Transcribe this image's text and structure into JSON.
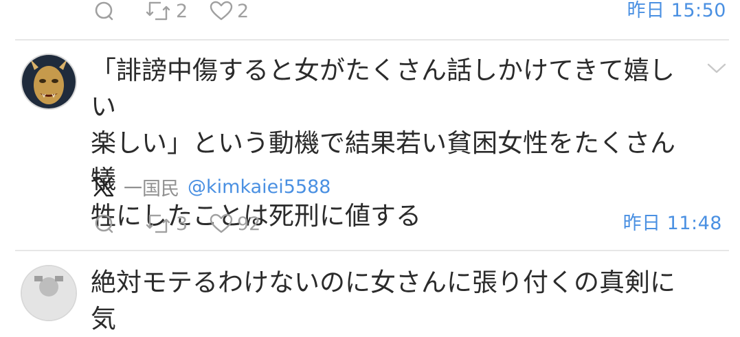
{
  "tweets": [
    {
      "replies": "",
      "retweets": "2",
      "likes": "2",
      "timestamp": "昨日 15:50"
    },
    {
      "text": "「誹謗中傷すると女がたくさん話しかけてきて嬉しい\n楽しい」という動機で結果若い貧困女性をたくさん犠\n牲にしたことは死刑に値する",
      "source_icon": "x-logo-icon",
      "source_name": "一国民",
      "source_handle": "@kimkaiei5588",
      "replies": "",
      "retweets": "3",
      "likes": "92",
      "timestamp": "昨日 11:48"
    },
    {
      "text": "絶対モテるわけないのに女さんに張り付くの真剣に気"
    }
  ],
  "colors": {
    "link": "#4a90e2",
    "muted": "#a0a0a0",
    "divider": "#e6e6e6"
  }
}
